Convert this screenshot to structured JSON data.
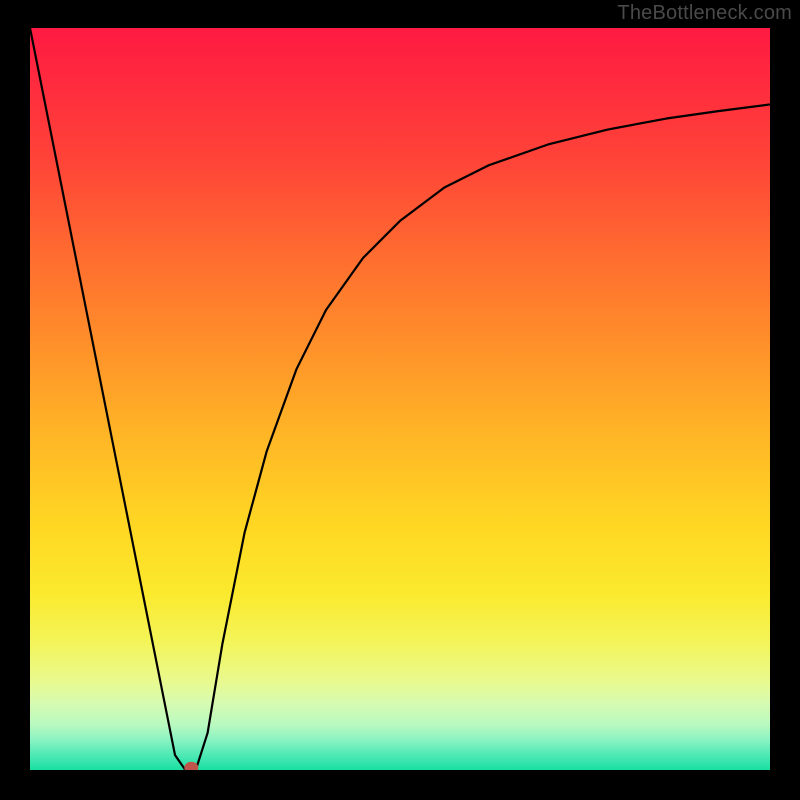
{
  "attribution": "TheBottleneck.com",
  "chart_data": {
    "type": "line",
    "title": "",
    "xlabel": "",
    "ylabel": "",
    "xlim": [
      0,
      1
    ],
    "ylim": [
      0,
      1
    ],
    "series": [
      {
        "name": "curve",
        "x": [
          0.0,
          0.04,
          0.08,
          0.12,
          0.16,
          0.18,
          0.196,
          0.21,
          0.224,
          0.24,
          0.26,
          0.29,
          0.32,
          0.36,
          0.4,
          0.45,
          0.5,
          0.56,
          0.62,
          0.7,
          0.78,
          0.86,
          0.93,
          1.0
        ],
        "y": [
          1.0,
          0.8,
          0.6,
          0.4,
          0.2,
          0.1,
          0.02,
          0.0,
          0.0,
          0.05,
          0.17,
          0.32,
          0.43,
          0.54,
          0.62,
          0.69,
          0.74,
          0.785,
          0.815,
          0.843,
          0.863,
          0.878,
          0.888,
          0.897
        ]
      }
    ],
    "marker": {
      "x": 0.218,
      "y": 0.003,
      "color": "#c0564b"
    },
    "background_gradient": {
      "top": "#ff1a42",
      "bottom": "#19dfa0"
    }
  }
}
